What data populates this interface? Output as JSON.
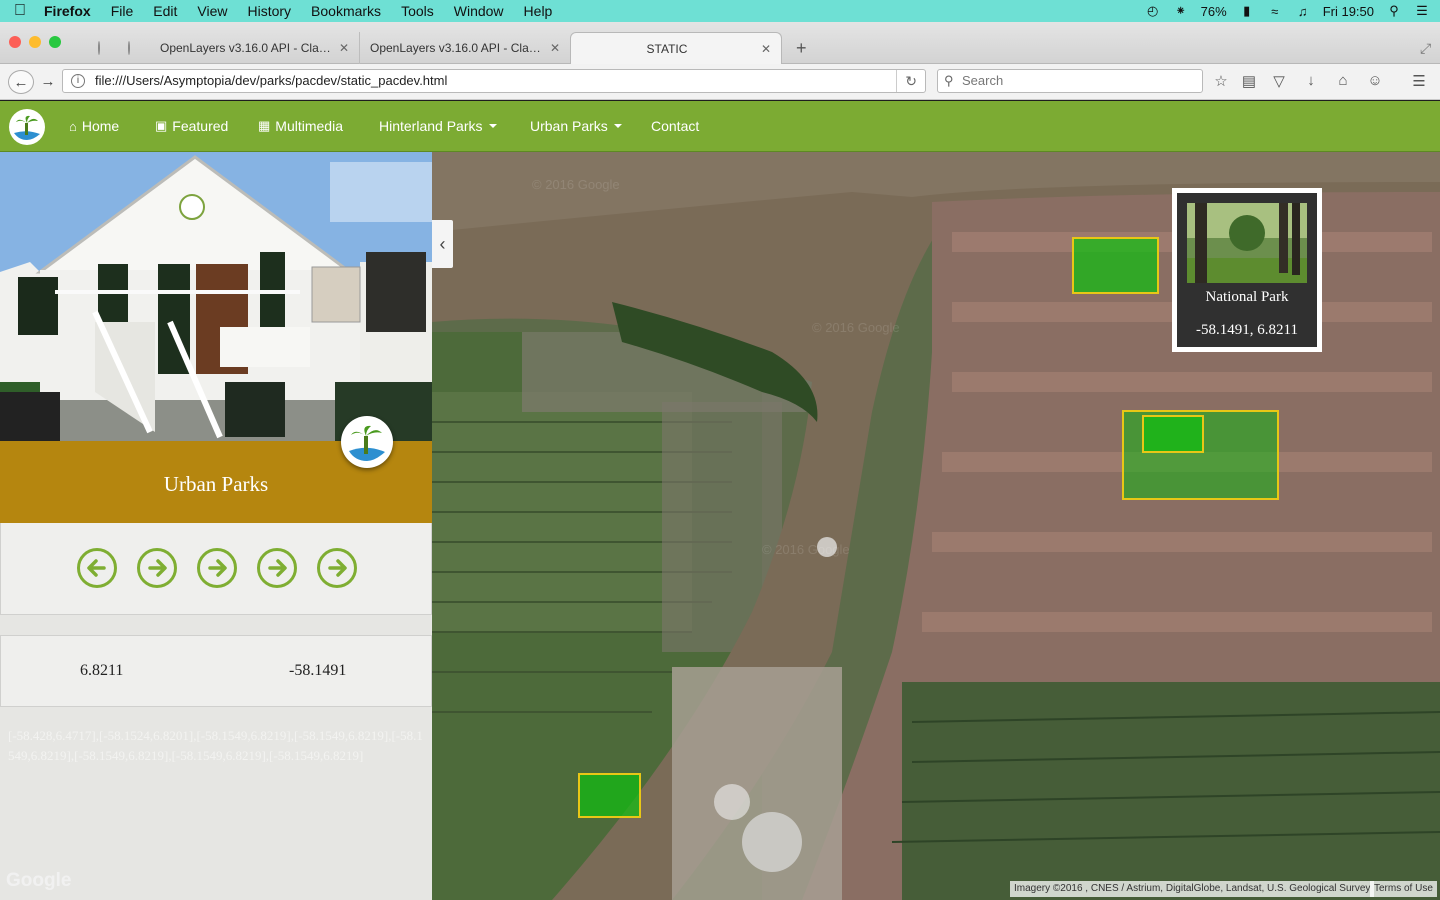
{
  "menubar": {
    "app": "Firefox",
    "items": [
      "File",
      "Edit",
      "View",
      "History",
      "Bookmarks",
      "Tools",
      "Window",
      "Help"
    ],
    "battery": "76%",
    "clock": "Fri 19:50"
  },
  "browser": {
    "tabs": [
      {
        "title": "OpenLayers v3.16.0 API - Clas…",
        "active": false
      },
      {
        "title": "OpenLayers v3.16.0 API - Clas…",
        "active": false
      },
      {
        "title": "STATIC",
        "active": true
      }
    ],
    "url": "file:///Users/Asymptopia/dev/parks/pacdev/static_pacdev.html",
    "search_placeholder": "Search"
  },
  "site_nav": {
    "items": [
      {
        "label": "Home",
        "icon": "home-icon"
      },
      {
        "label": "Featured",
        "icon": "film-icon"
      },
      {
        "label": "Multimedia",
        "icon": "picture-icon"
      },
      {
        "label": "Hinterland Parks",
        "dropdown": true
      },
      {
        "label": "Urban Parks",
        "dropdown": true
      },
      {
        "label": "Contact"
      }
    ]
  },
  "sidebar": {
    "section_title": "Urban Parks",
    "arrow_buttons": [
      "arrow-left-icon",
      "arrow-right-icon",
      "arrow-right-icon",
      "arrow-right-icon",
      "arrow-right-icon"
    ],
    "latitude": "6.8211",
    "longitude": "-58.1491",
    "coords_text": "[-58.428,6.4717],[-58.1524,6.8201],[-58.1549,6.8219],[-58.1549,6.8219],[-58.1549,6.8219],[-58.1549,6.8219],[-58.1549,6.8219],[-58.1549,6.8219]",
    "google_logo": "Google"
  },
  "map": {
    "popup": {
      "name": "National Park",
      "coords": "-58.1491, 6.8211"
    },
    "attribution": "Imagery ©2016 , CNES / Astrium, DigitalGlobe, Landsat, U.S. Geological Survey",
    "terms": "Terms of Use",
    "watermark": "© 2016 Google",
    "colors": {
      "park_fill": "#10be10",
      "park_border": "#e8c716",
      "nav_green": "#7cab33",
      "banner_gold": "#b5860f"
    }
  }
}
